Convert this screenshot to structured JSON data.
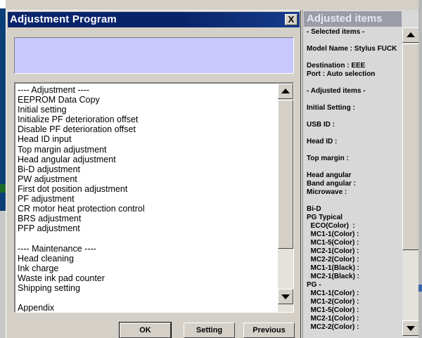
{
  "dialog": {
    "title": "Adjustment Program",
    "close_glyph": "X",
    "message": "",
    "menu_items": [
      "---- Adjustment ----",
      "EEPROM Data Copy",
      "Initial setting",
      "Initialize PF deterioration offset",
      "Disable PF deterioration offset",
      "Head ID input",
      "Top margin adjustment",
      "Head angular adjustment",
      "Bi-D adjustment",
      "PW adjustment",
      "First dot position adjustment",
      "PF adjustment",
      "CR motor heat protection control",
      "BRS adjustment",
      "PFP adjustment",
      "",
      "---- Maintenance ----",
      "Head cleaning",
      "Ink charge",
      "Waste ink pad counter",
      "Shipping setting",
      "",
      "       Appendix"
    ],
    "buttons": {
      "ok": "OK",
      "setting": "Setting",
      "previous": "Previous"
    }
  },
  "panel": {
    "title": "Adjusted items",
    "lines": [
      "- Selected items -",
      "",
      "Model Name : Stylus FUCK",
      "",
      "Destination : EEE",
      "Port : Auto selection",
      "",
      "- Adjusted items -",
      "",
      "Initial Setting :",
      "",
      "USB ID :",
      "",
      "Head ID :",
      "",
      "Top margin :",
      "",
      "Head angular",
      "Band angular :",
      "Microwave :",
      "",
      "Bi-D",
      "PG Typical",
      "  ECO(Color)  :",
      "  MC1-1(Color) :",
      "  MC1-5(Color) :",
      "  MC2-1(Color) :",
      "  MC2-2(Color) :",
      "  MC1-1(Black) :",
      "  MC2-1(Black) :",
      "PG -",
      "  MC1-1(Color) :",
      "  MC1-2(Color) :",
      "  MC1-5(Color) :",
      "  MC2-1(Color) :",
      "  MC2-2(Color) :"
    ]
  },
  "colors": {
    "title_bar": "#0a246a",
    "message_area": "#c8c8ff",
    "panel_title": "#9a9ca8"
  }
}
